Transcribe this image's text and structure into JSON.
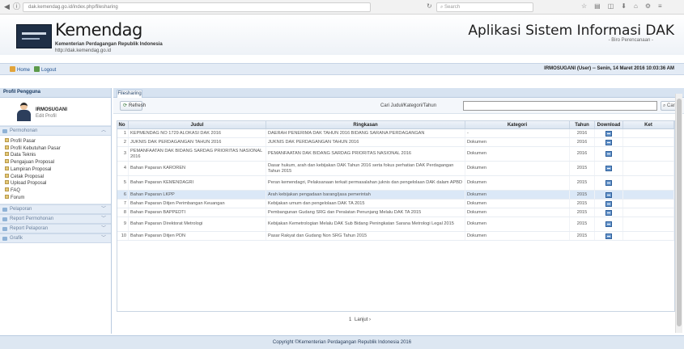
{
  "browser": {
    "url": "dak.kemendag.go.id/index.php/filesharing",
    "search_placeholder": "Search"
  },
  "header": {
    "brand": "Kemendag",
    "brand_sub": "Kementerian Perdagangan Republik Indonesia",
    "brand_url": "http://dak.kemendag.go.id",
    "app_title": "Aplikasi Sistem Informasi DAK",
    "app_sub": "- Biro Perencanaan -"
  },
  "toolbar": {
    "home": "Home",
    "logout": "Logout",
    "user_status": "IRMOSUGANI (User) -- Senin, 14 Maret 2016 10:03:36 AM"
  },
  "sidebar": {
    "profile_title": "Profil Pengguna",
    "user_name": "IRMOSUGANI",
    "edit_label": "Edit Profil",
    "sections": [
      {
        "label": "Permohonan",
        "items": [
          "Profil Pasar",
          "Profil Kebutuhan Pasar",
          "Data Teknis",
          "Pengajuan Proposal",
          "Lampiran Proposal",
          "Cetak Proposal",
          "Upload Proposal",
          "FAQ",
          "Forum"
        ]
      },
      {
        "label": "Pelaporan",
        "items": []
      },
      {
        "label": "Report Permohonan",
        "items": []
      },
      {
        "label": "Report Pelaporan",
        "items": []
      },
      {
        "label": "Grafik",
        "items": []
      }
    ]
  },
  "main": {
    "tab": "Filesharing",
    "refresh": "Refresh",
    "search_label": "Cari Judul/Kategori/Tahun",
    "search_value": "",
    "search_button": "Cari",
    "columns": [
      "No",
      "Judul",
      "Ringkasan",
      "Kategori",
      "Tahun",
      "Download",
      "Ket"
    ],
    "rows": [
      {
        "no": "1",
        "judul": "KEPMENDAG NO 1729 ALOKASI DAK 2016",
        "ringkasan": "DAERAH PENERIMA DAK TAHUN 2016 BIDANG SARANA PERDAGANGAN",
        "kategori": "-",
        "tahun": "2016"
      },
      {
        "no": "2",
        "judul": "JUKNIS DAK PERDAGANGAN TAHUN 2016",
        "ringkasan": "JUKNIS DAK PERDAGANGAN TAHUN 2016",
        "kategori": "Dokumen",
        "tahun": "2016"
      },
      {
        "no": "3",
        "judul": "PEMANFAATAN DAK BIDANG SARDAG PRIORITAS NASIONAL 2016",
        "ringkasan": "PEMANFAATAN DAK BIDANG SARDAG PRIORITAS NASIONAL 2016",
        "kategori": "Dokumen",
        "tahun": "2016"
      },
      {
        "no": "4",
        "judul": "Bahan Paparan KAROREN",
        "ringkasan": "Dasar hukum, arah dan kebijakan DAK Tahun 2016 serta fokus perhatian DAK Perdagangan Tahun 2015",
        "kategori": "Dokumen",
        "tahun": "2015"
      },
      {
        "no": "5",
        "judul": "Bahan Paparan KEMENDAGRI",
        "ringkasan": "Peran kemendagri, Pelaksanaan terkait permasalahan juknis dan pengelolaan DAK dalam APBD",
        "kategori": "Dokumen",
        "tahun": "2015"
      },
      {
        "no": "6",
        "judul": "Bahan Paparan LKPP",
        "ringkasan": "Arah kebijakan pengadaan barang/jasa pemerintah",
        "kategori": "Dokumen",
        "tahun": "2015"
      },
      {
        "no": "7",
        "judul": "Bahan Paparan Ditjen Perimbangan Keuangan",
        "ringkasan": "Kebijakan umum dan pengelolaan DAK TA 2015",
        "kategori": "Dokumen",
        "tahun": "2015"
      },
      {
        "no": "8",
        "judul": "Bahan Paparan BAPPEDTI",
        "ringkasan": "Pembangunan Gudang SRG dan Peralatan Penunjang Melalu DAK TA 2015",
        "kategori": "Dokumen",
        "tahun": "2015"
      },
      {
        "no": "9",
        "judul": "Bahan Paparan Direktorat Metrologi",
        "ringkasan": "Kebijakan Kemetrologian Melalu DAK Sub Bidang Peningkatan Sarana Metrologi Legal 2015",
        "kategori": "Dokumen",
        "tahun": "2015"
      },
      {
        "no": "10",
        "judul": "Bahan Paparan Ditjen PDN",
        "ringkasan": "Pasar Rakyat dan Gudang Non SRG Tahun 2015",
        "kategori": "Dokumen",
        "tahun": "2015"
      }
    ],
    "pager": {
      "page": "1",
      "next": "Lanjut ›"
    }
  },
  "footer": "Copyright ©Kementerian Perdagangan Republik Indonesia 2016",
  "colors": {
    "header_bg": "#d7e3f1",
    "selected_row": "#dbe8f7",
    "link": "#1c4f8f"
  }
}
